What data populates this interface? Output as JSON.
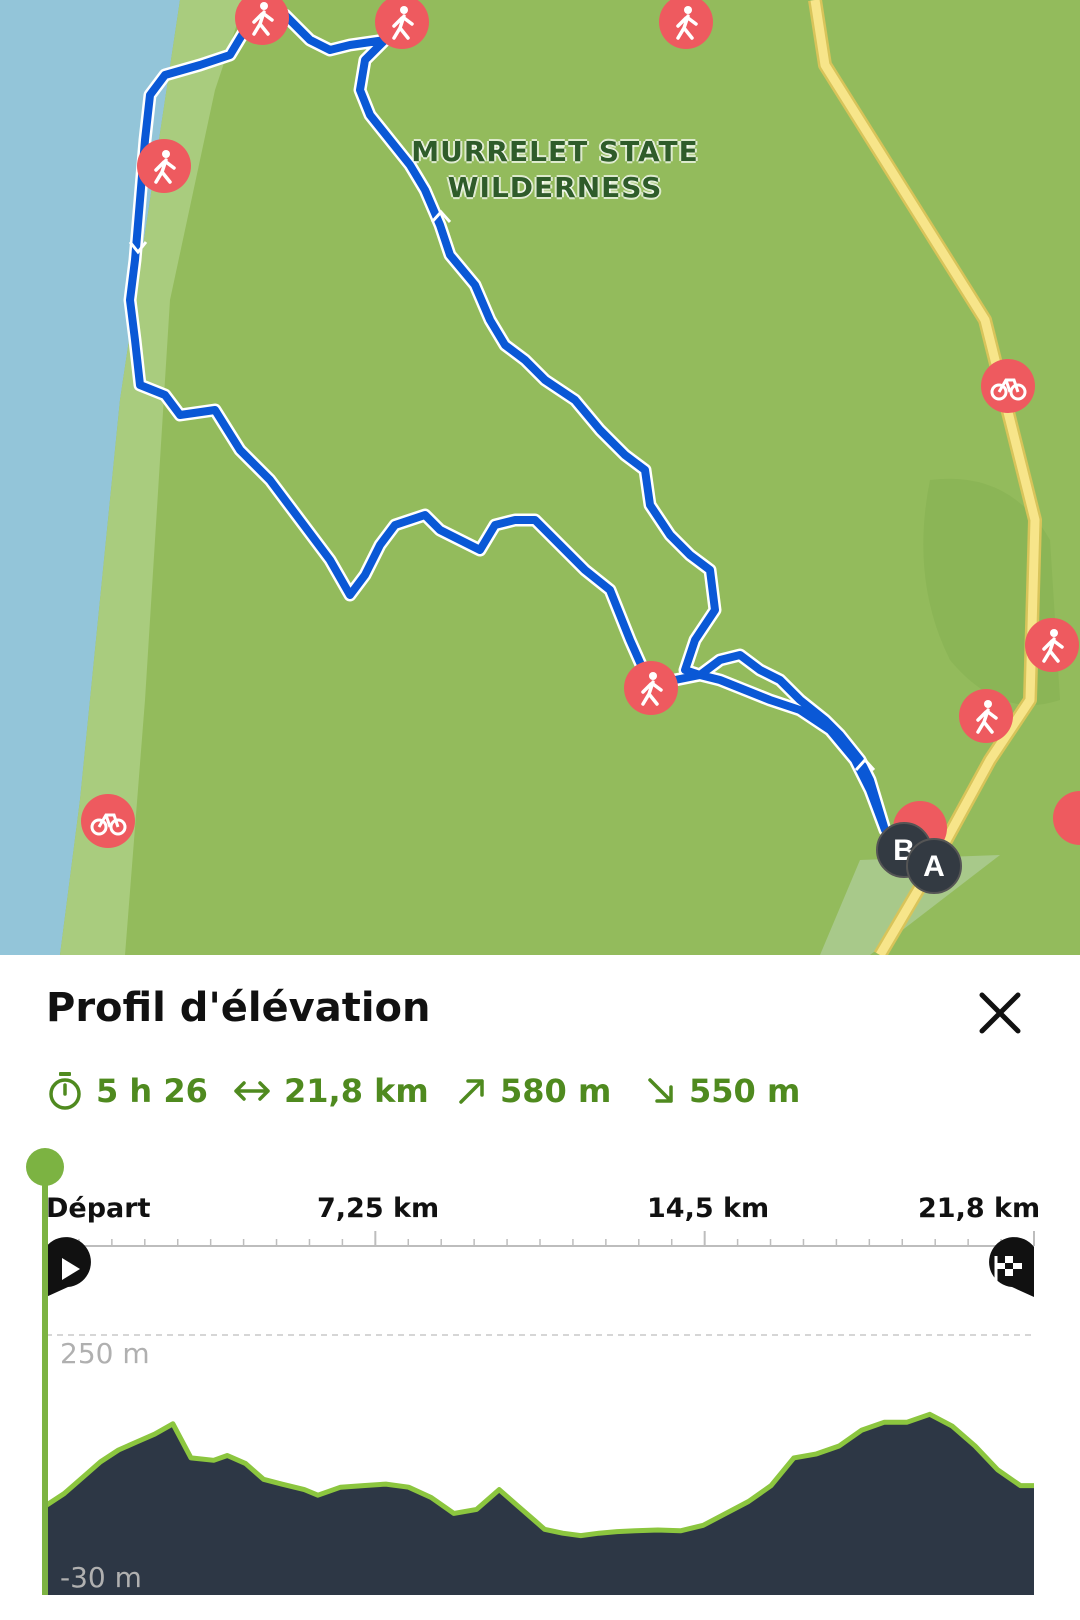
{
  "map": {
    "area_label": [
      "MURRELET STATE",
      "WILDERNESS"
    ],
    "markers": {
      "start": "A",
      "end": "B"
    },
    "colors": {
      "ocean": "#93c5d9",
      "beach": "#a9cc7e",
      "forest": "#93bb5c",
      "road": "#f7e58a",
      "route": "#0a58d6",
      "poi": "#ee5a5f"
    }
  },
  "panel": {
    "title": "Profil d'élévation",
    "stats": {
      "duration": "5 h 26",
      "distance": "21,8 km",
      "ascent": "580 m",
      "descent": "550 m"
    },
    "icons": {
      "duration": "stopwatch-icon",
      "distance": "horizontal-arrows-icon",
      "ascent": "arrow-up-right-icon",
      "descent": "arrow-down-right-icon",
      "start": "play-pin-icon",
      "finish": "finish-flag-pin-icon",
      "close": "close-icon"
    }
  },
  "chart_data": {
    "type": "area",
    "x_unit": "km",
    "y_unit": "m",
    "xlim": [
      0,
      21.8
    ],
    "ylim": [
      -30,
      250
    ],
    "x_ticks": [
      "Départ",
      "7,25 km",
      "14,5 km",
      "21,8 km"
    ],
    "y_ticks": [
      "250 m",
      "-30 m"
    ],
    "x": [
      0,
      0.4,
      0.8,
      1.2,
      1.6,
      2.0,
      2.4,
      2.8,
      3.2,
      3.7,
      4.0,
      4.4,
      4.8,
      5.2,
      5.7,
      6.0,
      6.5,
      7.0,
      7.5,
      8.0,
      8.5,
      9.0,
      9.5,
      10.0,
      10.4,
      10.8,
      11.0,
      11.4,
      11.8,
      12.2,
      12.6,
      13.0,
      13.5,
      14.0,
      14.5,
      15.0,
      15.5,
      16.0,
      16.5,
      17.0,
      17.5,
      18.0,
      18.5,
      19.0,
      19.5,
      20.0,
      20.5,
      21.0,
      21.5,
      21.8
    ],
    "y": [
      35,
      50,
      70,
      90,
      105,
      115,
      125,
      138,
      95,
      92,
      98,
      88,
      68,
      62,
      55,
      48,
      58,
      60,
      62,
      58,
      45,
      25,
      30,
      55,
      35,
      15,
      5,
      0,
      -3,
      0,
      2,
      3,
      4,
      3,
      10,
      25,
      40,
      60,
      95,
      100,
      110,
      130,
      140,
      140,
      150,
      135,
      110,
      80,
      60,
      60
    ],
    "series": [
      {
        "values": [
          35,
          50,
          70,
          90,
          105,
          115,
          125,
          138,
          95,
          92,
          98,
          88,
          68,
          62,
          55,
          48,
          58,
          60,
          62,
          58,
          45,
          25,
          30,
          55,
          35,
          15,
          5,
          0,
          -3,
          0,
          2,
          3,
          4,
          3,
          10,
          25,
          40,
          60,
          95,
          100,
          110,
          130,
          140,
          140,
          150,
          135,
          110,
          80,
          60,
          60
        ]
      }
    ],
    "colors": {
      "fill": "#2d3745",
      "line": "#8cc63f",
      "cursor": "#7cb342"
    },
    "grid": false
  }
}
